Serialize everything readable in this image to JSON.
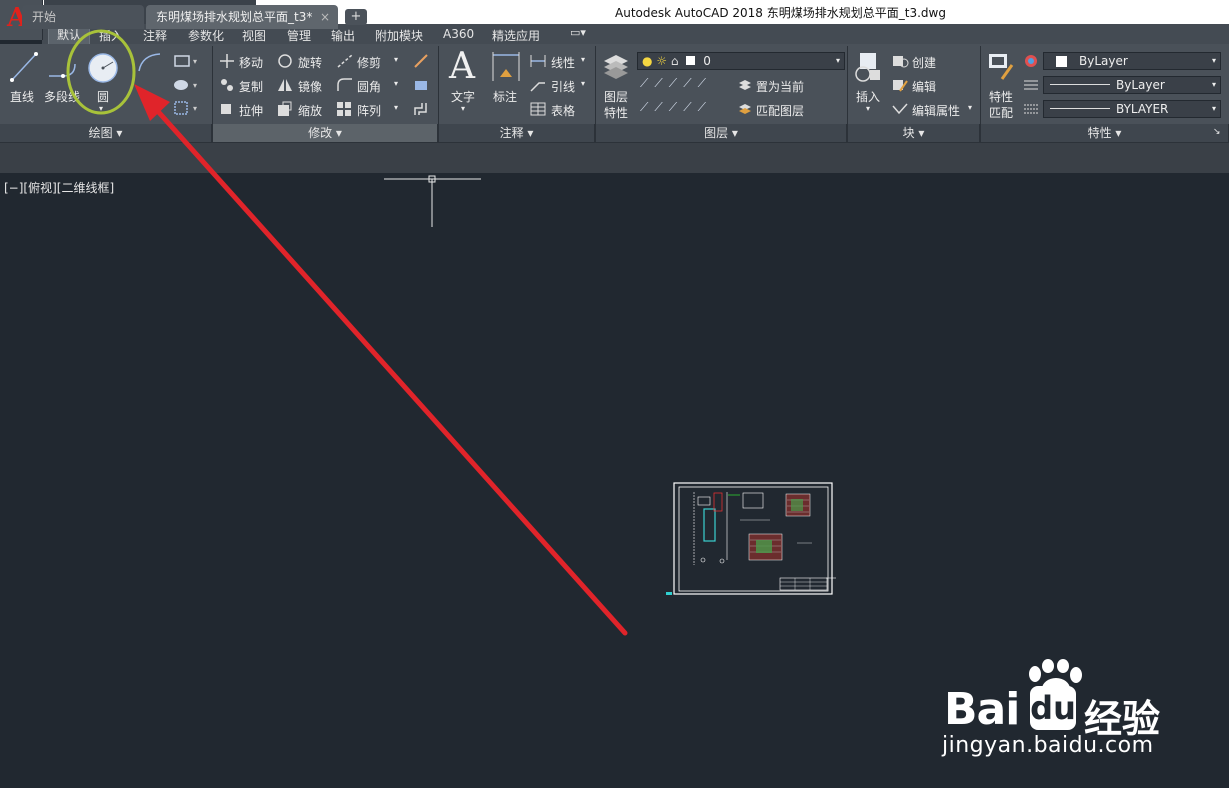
{
  "window": {
    "title": "Autodesk AutoCAD 2018    东明煤场排水规划总平面_t3.dwg"
  },
  "qat": {
    "icons": [
      "new-icon",
      "open-icon",
      "save-icon",
      "saveas-icon",
      "print-icon",
      "undo-icon",
      "redo-icon",
      "customize-icon"
    ]
  },
  "ribbon_tabs": [
    "默认",
    "插入",
    "注释",
    "参数化",
    "视图",
    "管理",
    "输出",
    "附加模块",
    "A360",
    "精选应用"
  ],
  "panels": {
    "draw": {
      "title": "绘图 ▾",
      "line": "直线",
      "polyline": "多段线",
      "circle": "圆"
    },
    "modify": {
      "title": "修改 ▾",
      "move": "移动",
      "rotate": "旋转",
      "trim": "修剪",
      "copy": "复制",
      "mirror": "镜像",
      "fillet": "圆角",
      "stretch": "拉伸",
      "scale": "缩放",
      "array": "阵列"
    },
    "annotation": {
      "title": "注释 ▾",
      "text": "文字",
      "dimension": "标注",
      "linear": "线性",
      "leader": "引线",
      "table": "表格"
    },
    "layers": {
      "title": "图层 ▾",
      "layer_props_1": "图层",
      "layer_props_2": "特性",
      "current_layer": "0",
      "make_current": "置为当前",
      "match_layer": "匹配图层"
    },
    "block": {
      "title": "块 ▾",
      "insert": "插入",
      "create": "创建",
      "edit": "编辑",
      "edit_attr": "编辑属性"
    },
    "properties": {
      "title": "特性 ▾",
      "match_1": "特性",
      "match_2": "匹配",
      "color": "ByLayer",
      "linetype": "ByLayer",
      "lineweight": "BYLAYER"
    }
  },
  "doc_tabs": {
    "start": "开始",
    "file": "东明煤场排水规划总平面_t3*",
    "close": "×",
    "new": "+"
  },
  "viewport": {
    "label": "[−][俯视][二维线框]"
  },
  "annotations": {
    "highlight_color": "#a8c23a",
    "arrow_color": "#e0242a"
  },
  "watermark": {
    "brand_a": "Bai",
    "brand_b": "du",
    "brand_c": "经验",
    "url": "jingyan.baidu.com"
  },
  "colors": {
    "background": "#212830",
    "ribbon": "#4a5159"
  }
}
